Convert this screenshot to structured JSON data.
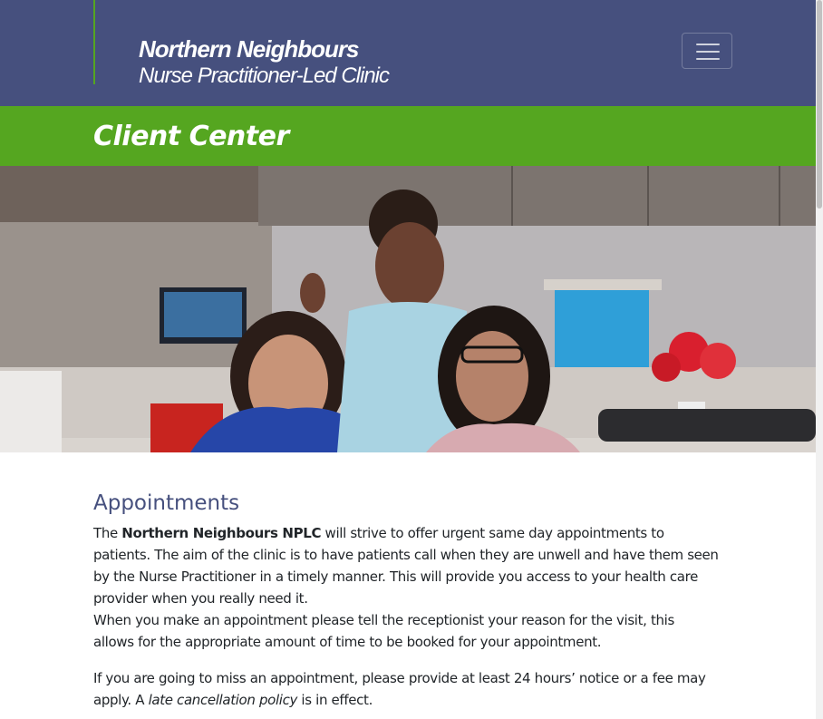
{
  "header": {
    "brand_line1": "Northern Neighbours",
    "brand_line2": "Nurse Practitioner-Led Clinic",
    "menu_icon": "hamburger-menu-icon"
  },
  "banner": {
    "title": "Client Center"
  },
  "hero": {
    "image": "photo-three-smiling-clinic-staff-at-reception-desk"
  },
  "appointments": {
    "heading": "Appointments",
    "p1_prefix": "The ",
    "p1_bold": "Northern Neighbours NPLC",
    "p1_rest": " will strive to offer urgent same day appointments to patients. The aim of the clinic is to have patients call when they are unwell and have them seen by the Nurse Practitioner in a timely manner. This will provide you access to your health care provider when you really need it.",
    "p1_line2": "When you make an appointment please tell the receptionist your reason for the visit, this allows for the appropriate amount of time to be booked for your appointment.",
    "p2_prefix": "If you are going to miss an appointment, please provide at least 24 hours’ notice or a fee may apply. A ",
    "p2_italic": "late cancellation policy",
    "p2_suffix": " is in effect."
  },
  "colors": {
    "header_bg": "#46507e",
    "accent_green": "#55a620",
    "heading_color": "#46507e",
    "body_text": "#212529"
  }
}
